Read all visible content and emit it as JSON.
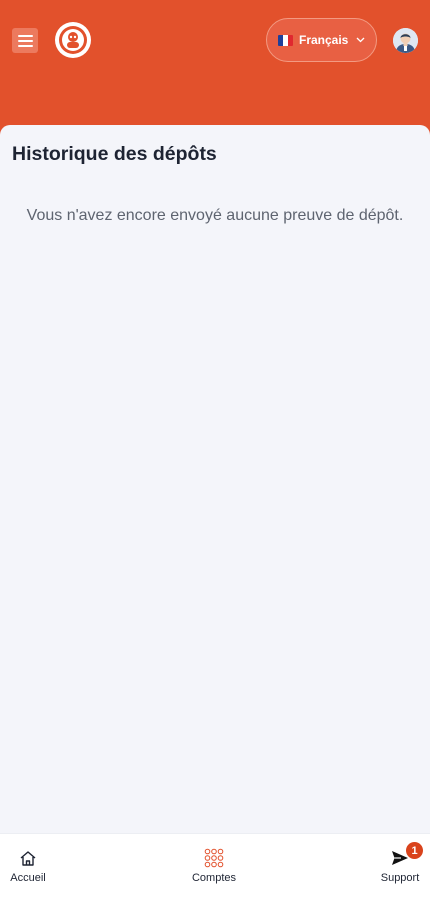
{
  "header": {
    "menu_icon": "hamburger-menu-icon",
    "logo_icon": "brand-logo-icon",
    "language": {
      "flag": "france-flag-icon",
      "label": "Français",
      "chevron_icon": "chevron-down-icon"
    },
    "avatar_icon": "user-avatar-icon"
  },
  "main": {
    "title": "Historique des dépôts",
    "empty_message": "Vous n'avez encore envoyé aucune preuve de dépôt."
  },
  "bottom_nav": {
    "items": [
      {
        "label": "Accueil",
        "icon": "home-icon"
      },
      {
        "label": "Comptes",
        "icon": "grid-dots-icon"
      },
      {
        "label": "Support",
        "icon": "send-icon",
        "badge": "1"
      }
    ]
  },
  "colors": {
    "header_bg": "#e2512c",
    "accent": "#d9431c",
    "background": "#f4f5fa",
    "text_dark": "#1e2433",
    "text_muted": "#5e6470"
  }
}
